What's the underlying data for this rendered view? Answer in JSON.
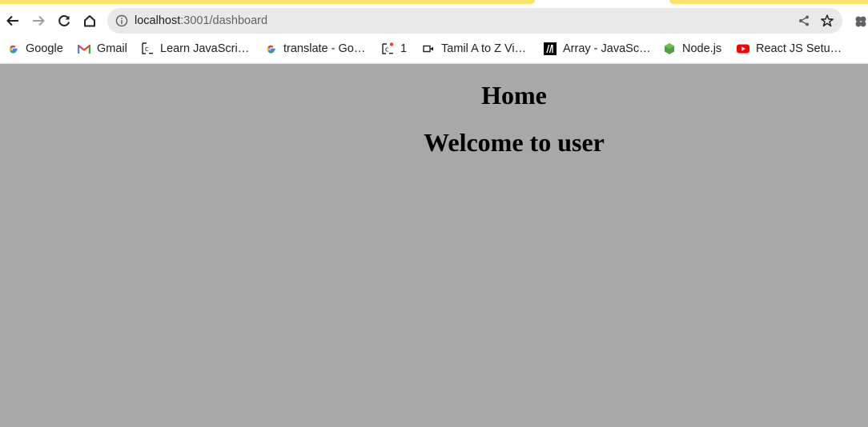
{
  "browser": {
    "accent_color": "#fbe26b",
    "toolbar": {
      "back_icon": "arrow-left-icon",
      "forward_icon": "arrow-right-icon",
      "reload_icon": "reload-icon",
      "home_icon": "home-icon"
    },
    "omnibox": {
      "host": "localhost",
      "path": ":3001/dashboard",
      "info_icon": "info-icon",
      "share_icon": "share-icon",
      "bookmark_icon": "star-icon"
    },
    "extensions_icon": "puzzle-icon",
    "bookmarks": [
      {
        "label": "Google",
        "icon": "google-icon"
      },
      {
        "label": "Gmail",
        "icon": "gmail-icon"
      },
      {
        "label": "Learn JavaScri…",
        "icon": "code-site-icon"
      },
      {
        "label": "translate - Go…",
        "icon": "google-icon"
      },
      {
        "label": "1",
        "icon": "code-site-notify-icon"
      },
      {
        "label": "Tamil A to Z Vi…",
        "icon": "video-icon"
      },
      {
        "label": "Array - JavaSc…",
        "icon": "mdn-icon"
      },
      {
        "label": "Node.js",
        "icon": "nodejs-icon"
      },
      {
        "label": "React JS Setu…",
        "icon": "youtube-icon"
      }
    ]
  },
  "page": {
    "background": "#a8a8a8",
    "title": "Home",
    "welcome": "Welcome to user"
  }
}
